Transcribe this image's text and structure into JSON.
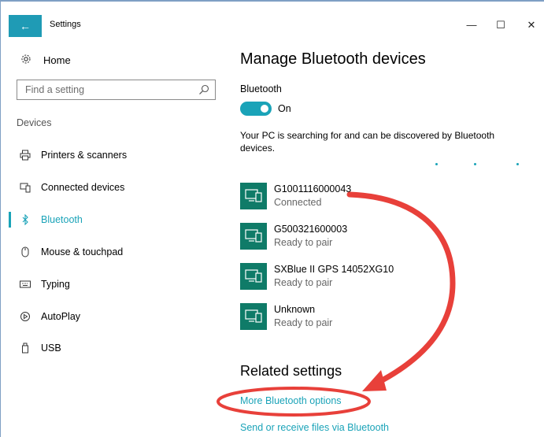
{
  "window": {
    "title": "Settings",
    "back_icon": "←",
    "minimize_icon": "—",
    "maximize_icon": "☐",
    "close_icon": "✕"
  },
  "sidebar": {
    "home": {
      "label": "Home",
      "icon": "gear-icon"
    },
    "search": {
      "placeholder": "Find a setting",
      "icon": "search-icon"
    },
    "section_label": "Devices",
    "items": [
      {
        "label": "Printers & scanners",
        "icon": "printer-icon",
        "active": false
      },
      {
        "label": "Connected devices",
        "icon": "connected-devices-icon",
        "active": false
      },
      {
        "label": "Bluetooth",
        "icon": "bluetooth-icon",
        "active": true
      },
      {
        "label": "Mouse & touchpad",
        "icon": "mouse-icon",
        "active": false
      },
      {
        "label": "Typing",
        "icon": "keyboard-icon",
        "active": false
      },
      {
        "label": "AutoPlay",
        "icon": "autoplay-icon",
        "active": false
      },
      {
        "label": "USB",
        "icon": "usb-icon",
        "active": false
      }
    ]
  },
  "main": {
    "title": "Manage Bluetooth devices",
    "bluetooth_label": "Bluetooth",
    "toggle_state": "On",
    "status_text": "Your PC is searching for and can be discovered by Bluetooth devices.",
    "devices": [
      {
        "name": "G1001116000043",
        "status": "Connected",
        "icon": "device-icon"
      },
      {
        "name": "G500321600003",
        "status": "Ready to pair",
        "icon": "device-icon"
      },
      {
        "name": "SXBlue II GPS 14052XG10",
        "status": "Ready to pair",
        "icon": "device-icon"
      },
      {
        "name": "Unknown",
        "status": "Ready to pair",
        "icon": "device-icon"
      }
    ],
    "related_title": "Related settings",
    "links": [
      {
        "label": "More Bluetooth options"
      },
      {
        "label": "Send or receive files via Bluetooth"
      }
    ]
  },
  "colors": {
    "accent": "#1aa3b8",
    "device_tile": "#0f7b68",
    "annotation": "#e8403a"
  }
}
